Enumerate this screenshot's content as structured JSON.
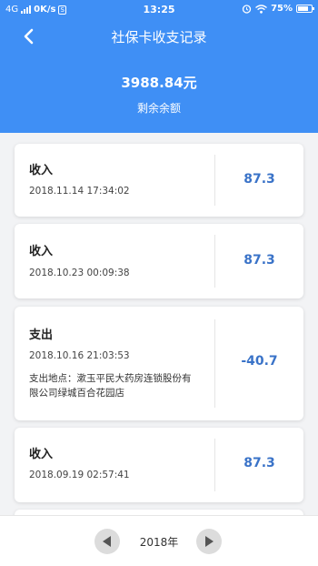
{
  "status_bar": {
    "network": "4G",
    "speed": "0K/s",
    "sim": "S",
    "time": "13:25",
    "battery": "75%",
    "battery_level": 0.75,
    "icons": [
      "signal-icon",
      "alarm-icon",
      "wifi-icon",
      "battery-icon"
    ]
  },
  "header": {
    "title": "社保卡收支记录",
    "back_icon": "chevron-left-icon",
    "balance": "3988.84元",
    "balance_label": "剩余余额",
    "color": "#3f8ff5"
  },
  "records": [
    {
      "type": "收入",
      "time": "2018.11.14 17:34:02",
      "amount": "87.3"
    },
    {
      "type": "收入",
      "time": "2018.10.23 00:09:38",
      "amount": "87.3"
    },
    {
      "type": "支出",
      "time": "2018.10.16 21:03:53",
      "amount": "-40.7",
      "place_label": "支出地点：",
      "place_line1": "漱玉平民大药房连锁股份有",
      "place_line2": "限公司绿城百合花园店"
    },
    {
      "type": "收入",
      "time": "2018.09.19 02:57:41",
      "amount": "87.3"
    }
  ],
  "amount_color": "#3a73c8",
  "footer": {
    "year": "2018年",
    "prev_icon": "triangle-left-icon",
    "next_icon": "triangle-right-icon"
  }
}
